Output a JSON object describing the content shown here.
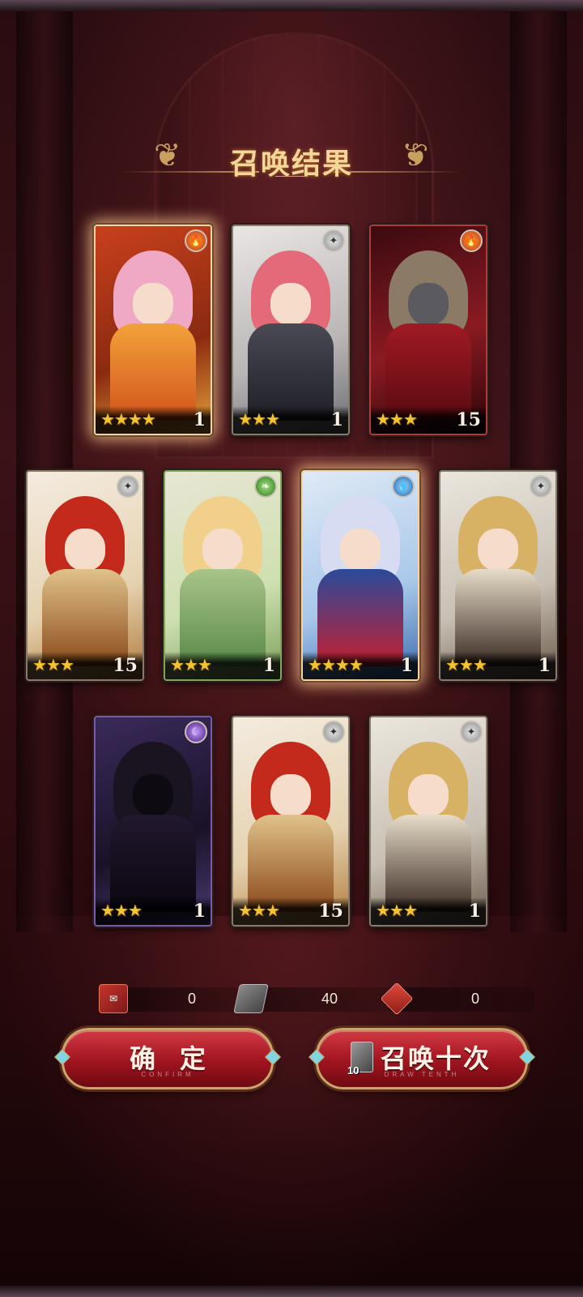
{
  "title": "召唤结果",
  "cards": [
    {
      "stars": "★★★★",
      "count": "1",
      "element": "fire",
      "element_glyph": "🔥"
    },
    {
      "stars": "★★★",
      "count": "1",
      "element": "light",
      "element_glyph": "✦"
    },
    {
      "stars": "★★★",
      "count": "15",
      "element": "fire",
      "element_glyph": "🔥"
    },
    {
      "stars": "★★★",
      "count": "15",
      "element": "light",
      "element_glyph": "✦"
    },
    {
      "stars": "★★★",
      "count": "1",
      "element": "nature",
      "element_glyph": "❧"
    },
    {
      "stars": "★★★★",
      "count": "1",
      "element": "water",
      "element_glyph": "💧"
    },
    {
      "stars": "★★★",
      "count": "1",
      "element": "light",
      "element_glyph": "✦"
    },
    {
      "stars": "★★★",
      "count": "1",
      "element": "dark",
      "element_glyph": "☾"
    },
    {
      "stars": "★★★",
      "count": "15",
      "element": "light",
      "element_glyph": "✦"
    },
    {
      "stars": "★★★",
      "count": "1",
      "element": "light",
      "element_glyph": "✦"
    }
  ],
  "currencies": [
    {
      "icon": "scroll-icon",
      "value": "0"
    },
    {
      "icon": "ticket-icon",
      "value": "40"
    },
    {
      "icon": "gem-icon",
      "value": "0"
    }
  ],
  "buttons": {
    "confirm_label": "确定",
    "confirm_sub": "CONFIRM",
    "draw_label": "召唤十次",
    "draw_sub": "DRAW TENTH",
    "draw_ticket_count": "10"
  },
  "colors": {
    "star": "#f2c431",
    "button_red": "#a0141f",
    "gold_trim": "#c8a66a",
    "title_gold": "#f3d79a"
  }
}
